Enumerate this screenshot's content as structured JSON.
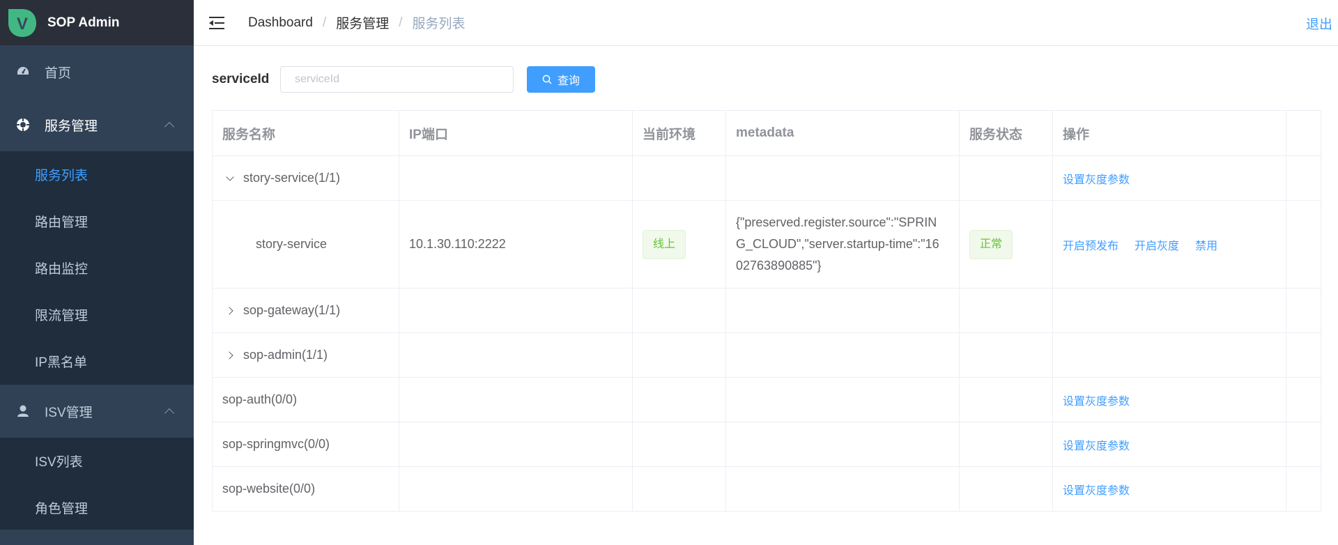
{
  "app": {
    "title": "SOP Admin",
    "logo_letter": "V"
  },
  "sidebar": {
    "items": [
      {
        "label": "首页",
        "icon": "dashboard-icon"
      },
      {
        "label": "服务管理",
        "icon": "service-icon",
        "expanded": true,
        "children": [
          {
            "label": "服务列表",
            "active": true
          },
          {
            "label": "路由管理"
          },
          {
            "label": "路由监控"
          },
          {
            "label": "限流管理"
          },
          {
            "label": "IP黑名单"
          }
        ]
      },
      {
        "label": "ISV管理",
        "icon": "user-icon",
        "expanded": true,
        "children": [
          {
            "label": "ISV列表"
          },
          {
            "label": "角色管理"
          }
        ]
      }
    ]
  },
  "navbar": {
    "breadcrumb": [
      "Dashboard",
      "服务管理",
      "服务列表"
    ],
    "logout": "退出"
  },
  "filter": {
    "label": "serviceId",
    "placeholder": "serviceId",
    "value": "",
    "query_button": "查询"
  },
  "table": {
    "columns": [
      "服务名称",
      "IP端口",
      "当前环境",
      "metadata",
      "服务状态",
      "操作"
    ],
    "rows": [
      {
        "name": "story-service(1/1)",
        "expand": "down",
        "ip": "",
        "env": "",
        "metadata": "",
        "status": "",
        "actions": [
          "设置灰度参数"
        ]
      },
      {
        "name": "story-service",
        "child": true,
        "ip": "10.1.30.110:2222",
        "env": "线上",
        "metadata": "{\"preserved.register.source\":\"SPRING_CLOUD\",\"server.startup-time\":\"1602763890885\"}",
        "status": "正常",
        "actions": [
          "开启预发布",
          "开启灰度",
          "禁用"
        ]
      },
      {
        "name": "sop-gateway(1/1)",
        "expand": "right",
        "ip": "",
        "env": "",
        "metadata": "",
        "status": "",
        "actions": []
      },
      {
        "name": "sop-admin(1/1)",
        "expand": "right",
        "ip": "",
        "env": "",
        "metadata": "",
        "status": "",
        "actions": []
      },
      {
        "name": "sop-auth(0/0)",
        "ip": "",
        "env": "",
        "metadata": "",
        "status": "",
        "actions": [
          "设置灰度参数"
        ]
      },
      {
        "name": "sop-springmvc(0/0)",
        "ip": "",
        "env": "",
        "metadata": "",
        "status": "",
        "actions": [
          "设置灰度参数"
        ]
      },
      {
        "name": "sop-website(0/0)",
        "ip": "",
        "env": "",
        "metadata": "",
        "status": "",
        "actions": [
          "设置灰度参数"
        ]
      }
    ]
  },
  "colors": {
    "sidebar_bg": "#304156",
    "submenu_bg": "#1f2d3d",
    "accent": "#409eff",
    "success": "#67c23a",
    "logo_green": "#41b883"
  }
}
